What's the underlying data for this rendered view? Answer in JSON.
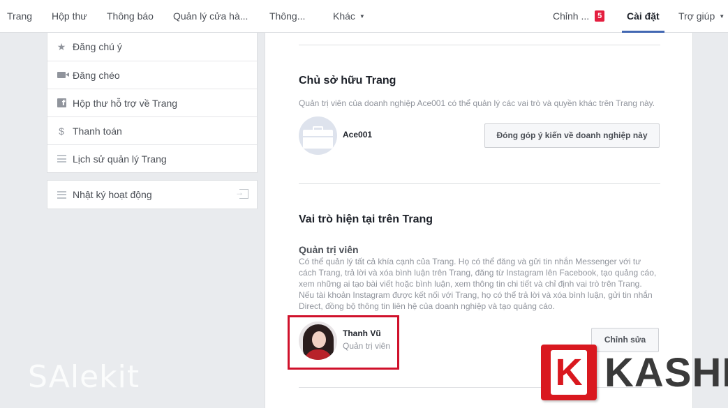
{
  "nav": {
    "items": [
      "Trang",
      "Hộp thư",
      "Thông báo",
      "Quản lý cửa hà...",
      "Thông...",
      "Khác"
    ],
    "edit_label": "Chỉnh ...",
    "edit_badge": "5",
    "settings_label": "Cài đặt",
    "help_label": "Trợ giúp",
    "active_tab": "Cài đặt"
  },
  "sidebar": {
    "items": [
      {
        "label": "Đăng chú ý",
        "icon": "star-icon"
      },
      {
        "label": "Đăng chéo",
        "icon": "video-camera-icon"
      },
      {
        "label": "Hộp thư hỗ trợ về Trang",
        "icon": "facebook-icon"
      },
      {
        "label": "Thanh toán",
        "icon": "dollar-icon"
      },
      {
        "label": "Lịch sử quản lý Trang",
        "icon": "history-icon"
      }
    ],
    "activity": {
      "label": "Nhật ký hoạt động",
      "icon": "list-icon",
      "action_icon": "exit-icon"
    }
  },
  "owner_section": {
    "title": "Chủ sở hữu Trang",
    "description": "Quản trị viên của doanh nghiệp Ace001 có thể quản lý các vai trò và quyền khác trên Trang này.",
    "business_name": "Ace001",
    "feedback_button": "Đóng góp ý kiến về doanh nghiệp này"
  },
  "roles_section": {
    "title": "Vai trò hiện tại trên Trang",
    "role_title": "Quản trị viên",
    "role_description": [
      "Có thể quản lý tất cả khía cạnh của Trang. Họ có thể đăng và gửi tin nhắn Messenger với tư",
      "cách Trang, trả lời và xóa bình luận trên Trang, đăng từ Instagram lên Facebook, tạo quảng cáo,",
      "xem những ai tạo bài viết hoặc bình luận, xem thông tin chi tiết và chỉ định vai trò trên Trang.",
      "Nếu tài khoản Instagram được kết nối với Trang, họ có thể trả lời và xóa bình luận, gửi tin nhắn",
      "Direct, đồng bộ thông tin liên hệ của doanh nghiệp và tạo quảng cáo."
    ],
    "user_name": "Thanh Vũ",
    "user_role": "Quản trị viên",
    "edit_button": "Chỉnh sửa"
  },
  "watermarks": {
    "salekit": "SAlekit",
    "kashi_letter": "K",
    "kashi": "KASHI"
  },
  "colors": {
    "accent": "#4267b2",
    "badge": "#e41e3f",
    "highlight": "#d0112b",
    "kashi_red": "#d9181f"
  }
}
